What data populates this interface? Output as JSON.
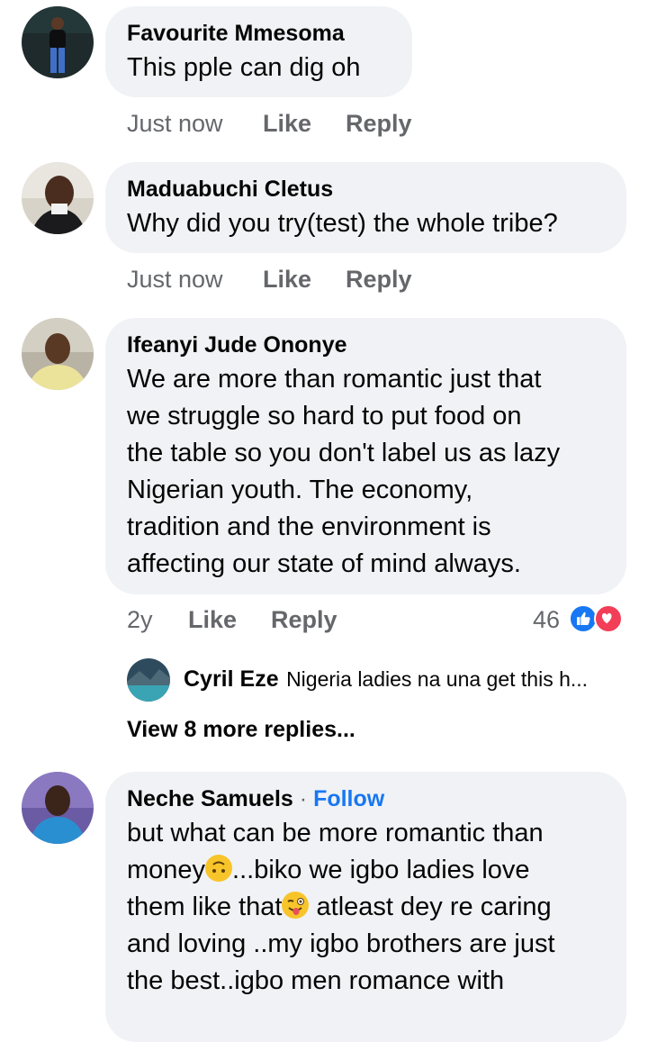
{
  "comments": [
    {
      "author": "Favourite Mmesoma",
      "text": "This pple can dig oh",
      "time": "Just now",
      "like_label": "Like",
      "reply_label": "Reply"
    },
    {
      "author": "Maduabuchi Cletus",
      "text": "Why did you try(test) the whole tribe?",
      "time": "Just now",
      "like_label": "Like",
      "reply_label": "Reply"
    },
    {
      "author": "Ifeanyi Jude Ononye",
      "text_lines": [
        "We are more than romantic just that",
        "we struggle so hard to put food on",
        "the table so you don't label us as lazy",
        "Nigerian youth. The economy,",
        "tradition and the  environment is",
        "affecting our state of mind always."
      ],
      "time": "2y",
      "like_label": "Like",
      "reply_label": "Reply",
      "reaction_count": "46",
      "reply_preview": {
        "author": "Cyril Eze",
        "text": "Nigeria ladies na una get this h..."
      },
      "view_more_label": "View 8 more replies..."
    },
    {
      "author": "Neche Samuels",
      "separator": "·",
      "follow_label": "Follow",
      "text_line1": "but what can be more romantic than",
      "text_line2_a": "money",
      "text_line2_b": "...biko we igbo ladies love",
      "text_line3_a": "them like that",
      "text_line3_b": " atleast dey re caring",
      "text_line4": "and loving ..my igbo brothers are just",
      "text_line5": "the best..igbo men romance with"
    }
  ],
  "colors": {
    "bubble": "#f0f2f5",
    "meta_text": "#65676b",
    "follow": "#1877f2",
    "like_reaction": "#1877f2",
    "love_reaction": "#f33e58"
  },
  "icons": {
    "like_reaction": "thumbs-up-icon",
    "love_reaction": "heart-icon",
    "upside_down_emoji": "upside-down-face-emoji",
    "winking_tongue_emoji": "winking-face-with-tongue-emoji"
  }
}
